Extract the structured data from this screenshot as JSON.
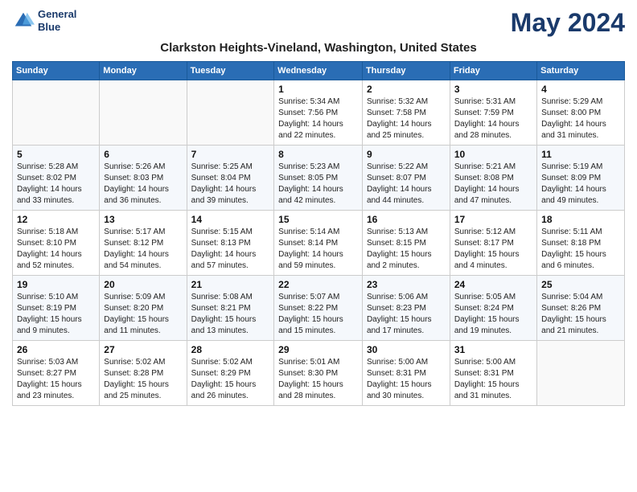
{
  "app": {
    "logo_line1": "General",
    "logo_line2": "Blue"
  },
  "title": "May 2024",
  "location": "Clarkston Heights-Vineland, Washington, United States",
  "days_of_week": [
    "Sunday",
    "Monday",
    "Tuesday",
    "Wednesday",
    "Thursday",
    "Friday",
    "Saturday"
  ],
  "weeks": [
    [
      {
        "day": "",
        "info": ""
      },
      {
        "day": "",
        "info": ""
      },
      {
        "day": "",
        "info": ""
      },
      {
        "day": "1",
        "info": "Sunrise: 5:34 AM\nSunset: 7:56 PM\nDaylight: 14 hours\nand 22 minutes."
      },
      {
        "day": "2",
        "info": "Sunrise: 5:32 AM\nSunset: 7:58 PM\nDaylight: 14 hours\nand 25 minutes."
      },
      {
        "day": "3",
        "info": "Sunrise: 5:31 AM\nSunset: 7:59 PM\nDaylight: 14 hours\nand 28 minutes."
      },
      {
        "day": "4",
        "info": "Sunrise: 5:29 AM\nSunset: 8:00 PM\nDaylight: 14 hours\nand 31 minutes."
      }
    ],
    [
      {
        "day": "5",
        "info": "Sunrise: 5:28 AM\nSunset: 8:02 PM\nDaylight: 14 hours\nand 33 minutes."
      },
      {
        "day": "6",
        "info": "Sunrise: 5:26 AM\nSunset: 8:03 PM\nDaylight: 14 hours\nand 36 minutes."
      },
      {
        "day": "7",
        "info": "Sunrise: 5:25 AM\nSunset: 8:04 PM\nDaylight: 14 hours\nand 39 minutes."
      },
      {
        "day": "8",
        "info": "Sunrise: 5:23 AM\nSunset: 8:05 PM\nDaylight: 14 hours\nand 42 minutes."
      },
      {
        "day": "9",
        "info": "Sunrise: 5:22 AM\nSunset: 8:07 PM\nDaylight: 14 hours\nand 44 minutes."
      },
      {
        "day": "10",
        "info": "Sunrise: 5:21 AM\nSunset: 8:08 PM\nDaylight: 14 hours\nand 47 minutes."
      },
      {
        "day": "11",
        "info": "Sunrise: 5:19 AM\nSunset: 8:09 PM\nDaylight: 14 hours\nand 49 minutes."
      }
    ],
    [
      {
        "day": "12",
        "info": "Sunrise: 5:18 AM\nSunset: 8:10 PM\nDaylight: 14 hours\nand 52 minutes."
      },
      {
        "day": "13",
        "info": "Sunrise: 5:17 AM\nSunset: 8:12 PM\nDaylight: 14 hours\nand 54 minutes."
      },
      {
        "day": "14",
        "info": "Sunrise: 5:15 AM\nSunset: 8:13 PM\nDaylight: 14 hours\nand 57 minutes."
      },
      {
        "day": "15",
        "info": "Sunrise: 5:14 AM\nSunset: 8:14 PM\nDaylight: 14 hours\nand 59 minutes."
      },
      {
        "day": "16",
        "info": "Sunrise: 5:13 AM\nSunset: 8:15 PM\nDaylight: 15 hours\nand 2 minutes."
      },
      {
        "day": "17",
        "info": "Sunrise: 5:12 AM\nSunset: 8:17 PM\nDaylight: 15 hours\nand 4 minutes."
      },
      {
        "day": "18",
        "info": "Sunrise: 5:11 AM\nSunset: 8:18 PM\nDaylight: 15 hours\nand 6 minutes."
      }
    ],
    [
      {
        "day": "19",
        "info": "Sunrise: 5:10 AM\nSunset: 8:19 PM\nDaylight: 15 hours\nand 9 minutes."
      },
      {
        "day": "20",
        "info": "Sunrise: 5:09 AM\nSunset: 8:20 PM\nDaylight: 15 hours\nand 11 minutes."
      },
      {
        "day": "21",
        "info": "Sunrise: 5:08 AM\nSunset: 8:21 PM\nDaylight: 15 hours\nand 13 minutes."
      },
      {
        "day": "22",
        "info": "Sunrise: 5:07 AM\nSunset: 8:22 PM\nDaylight: 15 hours\nand 15 minutes."
      },
      {
        "day": "23",
        "info": "Sunrise: 5:06 AM\nSunset: 8:23 PM\nDaylight: 15 hours\nand 17 minutes."
      },
      {
        "day": "24",
        "info": "Sunrise: 5:05 AM\nSunset: 8:24 PM\nDaylight: 15 hours\nand 19 minutes."
      },
      {
        "day": "25",
        "info": "Sunrise: 5:04 AM\nSunset: 8:26 PM\nDaylight: 15 hours\nand 21 minutes."
      }
    ],
    [
      {
        "day": "26",
        "info": "Sunrise: 5:03 AM\nSunset: 8:27 PM\nDaylight: 15 hours\nand 23 minutes."
      },
      {
        "day": "27",
        "info": "Sunrise: 5:02 AM\nSunset: 8:28 PM\nDaylight: 15 hours\nand 25 minutes."
      },
      {
        "day": "28",
        "info": "Sunrise: 5:02 AM\nSunset: 8:29 PM\nDaylight: 15 hours\nand 26 minutes."
      },
      {
        "day": "29",
        "info": "Sunrise: 5:01 AM\nSunset: 8:30 PM\nDaylight: 15 hours\nand 28 minutes."
      },
      {
        "day": "30",
        "info": "Sunrise: 5:00 AM\nSunset: 8:31 PM\nDaylight: 15 hours\nand 30 minutes."
      },
      {
        "day": "31",
        "info": "Sunrise: 5:00 AM\nSunset: 8:31 PM\nDaylight: 15 hours\nand 31 minutes."
      },
      {
        "day": "",
        "info": ""
      }
    ]
  ]
}
